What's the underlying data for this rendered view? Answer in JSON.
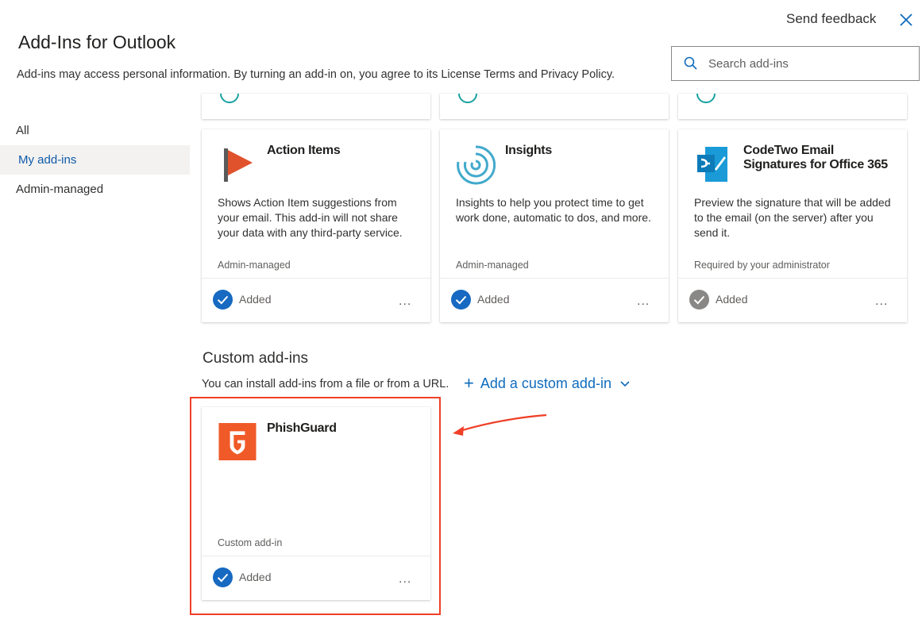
{
  "header": {
    "title": "Add-Ins for Outlook",
    "disclaimer": "Add-ins may access personal information. By turning an add-in on, you agree to its License Terms and Privacy Policy.",
    "feedback": "Send feedback"
  },
  "search": {
    "placeholder": "Search add-ins"
  },
  "nav": {
    "items": [
      "All",
      "My add-ins",
      "Admin-managed"
    ],
    "active": "My add-ins"
  },
  "cards": [
    {
      "name": "Action Items",
      "description": "Shows Action Item suggestions from your email. This add-in will not share your data with any third-party service.",
      "meta": "Admin-managed",
      "status": "Added",
      "more": "...",
      "icon": "flag-icon"
    },
    {
      "name": "Insights",
      "description": "Insights to help you protect time to get work done, automatic to dos, and more.",
      "meta": "Admin-managed",
      "status": "Added",
      "more": "...",
      "icon": "insights-icon"
    },
    {
      "name": "CodeTwo Email Signatures for Office 365",
      "description": "Preview the signature that will be added to the email (on the server) after you send it.",
      "meta": "Required by your administrator",
      "status": "Added",
      "more": "...",
      "icon": "codetwo-icon"
    }
  ],
  "custom_section": {
    "title": "Custom add-ins",
    "subtitle": "You can install add-ins from a file or from a URL.",
    "add_label": "Add a custom add-in",
    "card": {
      "name": "PhishGuard",
      "meta": "Custom add-in",
      "status": "Added",
      "more": "...",
      "icon": "phishguard-icon"
    }
  },
  "colors": {
    "accent": "#0f6cbd",
    "check_active": "#1769c1",
    "check_disabled": "#8a8886",
    "highlight": "#ef3f28",
    "phishguard": "#f05a28"
  }
}
